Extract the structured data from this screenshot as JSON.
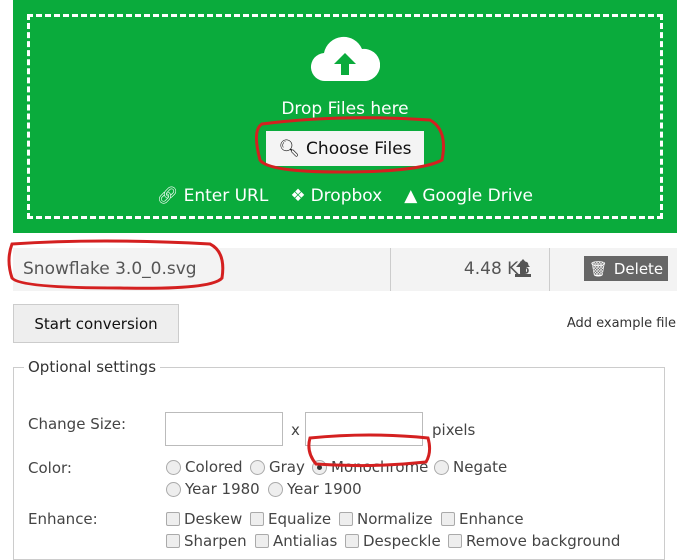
{
  "upload": {
    "drop_text": "Drop Files here",
    "choose_label": "Choose Files",
    "links": [
      {
        "label": "Enter URL",
        "icon": "link-icon"
      },
      {
        "label": "Dropbox",
        "icon": "dropbox-icon"
      },
      {
        "label": "Google Drive",
        "icon": "google-drive-icon"
      }
    ]
  },
  "file": {
    "name": "Snowflake 3.0_0.svg",
    "size": "4.48 KB",
    "delete_label": "Delete"
  },
  "actions": {
    "start_label": "Start conversion",
    "example_label": "Add example file"
  },
  "settings": {
    "legend": "Optional settings",
    "size_label": "Change Size:",
    "size_x": "x",
    "size_unit": "pixels",
    "width_value": "",
    "height_value": "",
    "color_label": "Color:",
    "color_options": [
      "Colored",
      "Gray",
      "Monochrome",
      "Negate",
      "Year 1980",
      "Year 1900"
    ],
    "color_selected": "Monochrome",
    "enhance_label": "Enhance:",
    "enhance_options": [
      "Deskew",
      "Equalize",
      "Normalize",
      "Enhance",
      "Sharpen",
      "Antialias",
      "Despeckle",
      "Remove background"
    ]
  },
  "colors": {
    "green": "#0aab3c",
    "annotation": "#d42020"
  }
}
